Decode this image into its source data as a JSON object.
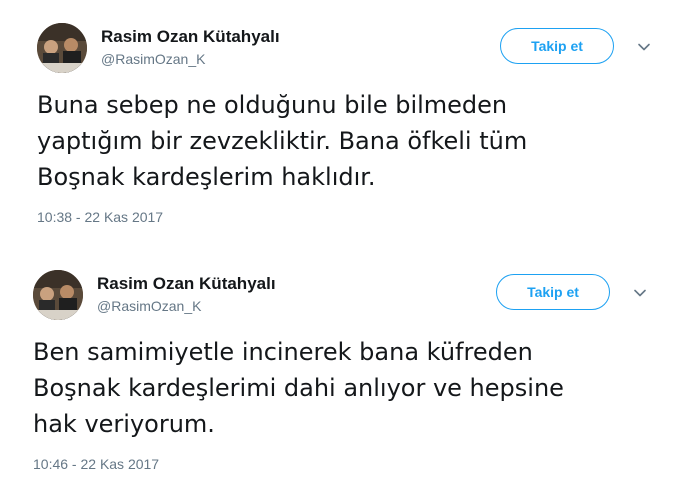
{
  "tweets": [
    {
      "author_name": "Rasim Ozan Kütahyalı",
      "author_handle": "@RasimOzan_K",
      "follow_label": "Takip et",
      "text": "Buna sebep ne olduğunu bile bilmeden\nyaptığım bir zevzekliktir. Bana öfkeli tüm\nBoşnak kardeşlerim haklıdır.",
      "timestamp": "10:38 - 22 Kas 2017"
    },
    {
      "author_name": "Rasim Ozan Kütahyalı",
      "author_handle": "@RasimOzan_K",
      "follow_label": "Takip et",
      "text": "Ben samimiyetle incinerek bana küfreden\nBoşnak kardeşlerimi dahi anlıyor ve hepsine\nhak veriyorum.",
      "timestamp": "10:46 - 22 Kas 2017"
    }
  ],
  "colors": {
    "accent": "#1da1f2",
    "text": "#14171a",
    "secondary": "#657786"
  },
  "icons": {
    "more": "chevron-down-icon"
  }
}
